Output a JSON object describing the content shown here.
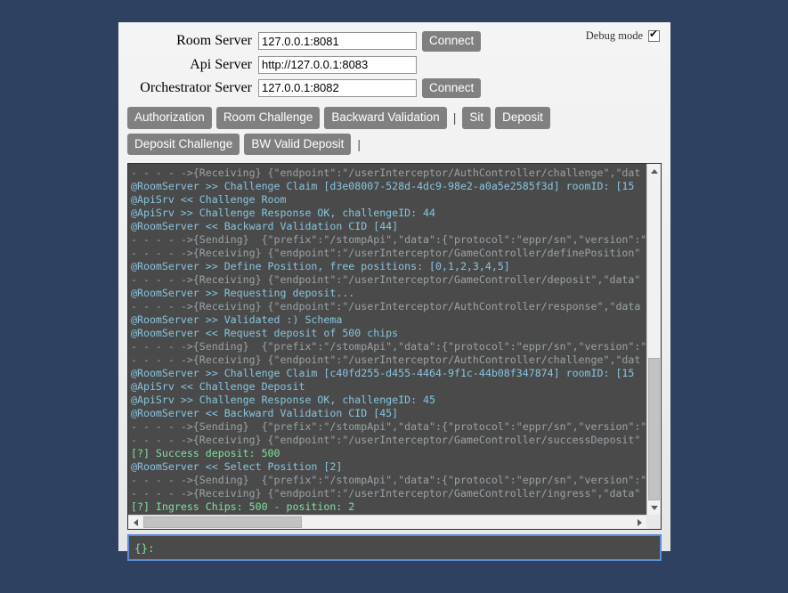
{
  "theme": {
    "page_background": "#2e4161",
    "panel_background": "#f0f0f0",
    "button_background": "#808080",
    "console_background": "#4a4a4a",
    "log_dim_color": "#9aa2a6",
    "log_blue_color": "#87c5e0",
    "log_green_color": "#7fe0a0",
    "input_focus_border": "#5b8dd9"
  },
  "debug": {
    "label": "Debug mode",
    "checked": true
  },
  "form": {
    "rows": [
      {
        "label": "Room Server",
        "value": "127.0.0.1:8081",
        "button": "Connect",
        "has_button": true
      },
      {
        "label": "Api Server",
        "value": "http://127.0.0.1:8083",
        "button": "",
        "has_button": false
      },
      {
        "label": "Orchestrator Server",
        "value": "127.0.0.1:8082",
        "button": "Connect",
        "has_button": true
      }
    ]
  },
  "actions": {
    "buttons": [
      "Authorization",
      "Room Challenge",
      "Backward Validation",
      "Sit",
      "Deposit",
      "Deposit Challenge",
      "BW Valid Deposit"
    ],
    "separator": "|"
  },
  "console": {
    "lines": [
      {
        "color": "dim",
        "text": "- - - - ->{Receiving} {\"endpoint\":\"/userInterceptor/AuthController/challenge\",\"dat"
      },
      {
        "color": "blue",
        "text": "@RoomServer >> Challenge Claim [d3e08007-528d-4dc9-98e2-a0a5e2585f3d] roomID: [15"
      },
      {
        "color": "blue",
        "text": "@ApiSrv << Challenge Room"
      },
      {
        "color": "blue",
        "text": "@ApiSrv >> Challenge Response OK, challengeID: 44"
      },
      {
        "color": "blue",
        "text": "@RoomServer << Backward Validation CID [44]"
      },
      {
        "color": "dim",
        "text": "- - - - ->{Sending}  {\"prefix\":\"/stompApi\",\"data\":{\"protocol\":\"eppr/sn\",\"version\":\""
      },
      {
        "color": "dim",
        "text": "- - - - ->{Receiving} {\"endpoint\":\"/userInterceptor/GameController/definePosition\""
      },
      {
        "color": "blue",
        "text": "@RoomServer >> Define Position, free positions: [0,1,2,3,4,5]"
      },
      {
        "color": "dim",
        "text": "- - - - ->{Receiving} {\"endpoint\":\"/userInterceptor/GameController/deposit\",\"data\""
      },
      {
        "color": "blue",
        "text": "@RoomServer >> Requesting deposit..."
      },
      {
        "color": "dim",
        "text": "- - - - ->{Receiving} {\"endpoint\":\"/userInterceptor/AuthController/response\",\"data"
      },
      {
        "color": "blue",
        "text": "@RoomServer >> Validated :) Schema"
      },
      {
        "color": "blue",
        "text": "@RoomServer << Request deposit of 500 chips"
      },
      {
        "color": "dim",
        "text": "- - - - ->{Sending}  {\"prefix\":\"/stompApi\",\"data\":{\"protocol\":\"eppr/sn\",\"version\":\""
      },
      {
        "color": "dim",
        "text": "- - - - ->{Receiving} {\"endpoint\":\"/userInterceptor/AuthController/challenge\",\"dat"
      },
      {
        "color": "blue",
        "text": "@RoomServer >> Challenge Claim [c40fd255-d455-4464-9f1c-44b08f347874] roomID: [15"
      },
      {
        "color": "blue",
        "text": "@ApiSrv << Challenge Deposit"
      },
      {
        "color": "blue",
        "text": "@ApiSrv >> Challenge Response OK, challengeID: 45"
      },
      {
        "color": "blue",
        "text": "@RoomServer << Backward Validation CID [45]"
      },
      {
        "color": "dim",
        "text": "- - - - ->{Sending}  {\"prefix\":\"/stompApi\",\"data\":{\"protocol\":\"eppr/sn\",\"version\":\""
      },
      {
        "color": "dim",
        "text": "- - - - ->{Receiving} {\"endpoint\":\"/userInterceptor/GameController/successDeposit\""
      },
      {
        "color": "green",
        "text": "[?] Success deposit: 500"
      },
      {
        "color": "blue",
        "text": "@RoomServer << Select Position [2]"
      },
      {
        "color": "dim",
        "text": "- - - - ->{Sending}  {\"prefix\":\"/stompApi\",\"data\":{\"protocol\":\"eppr/sn\",\"version\":\""
      },
      {
        "color": "dim",
        "text": "- - - - ->{Receiving} {\"endpoint\":\"/userInterceptor/GameController/ingress\",\"data\""
      },
      {
        "color": "green",
        "text": "[?] Ingress Chips: 500 - position: 2"
      }
    ]
  },
  "command_input": {
    "value": "{}:",
    "placeholder": ""
  }
}
